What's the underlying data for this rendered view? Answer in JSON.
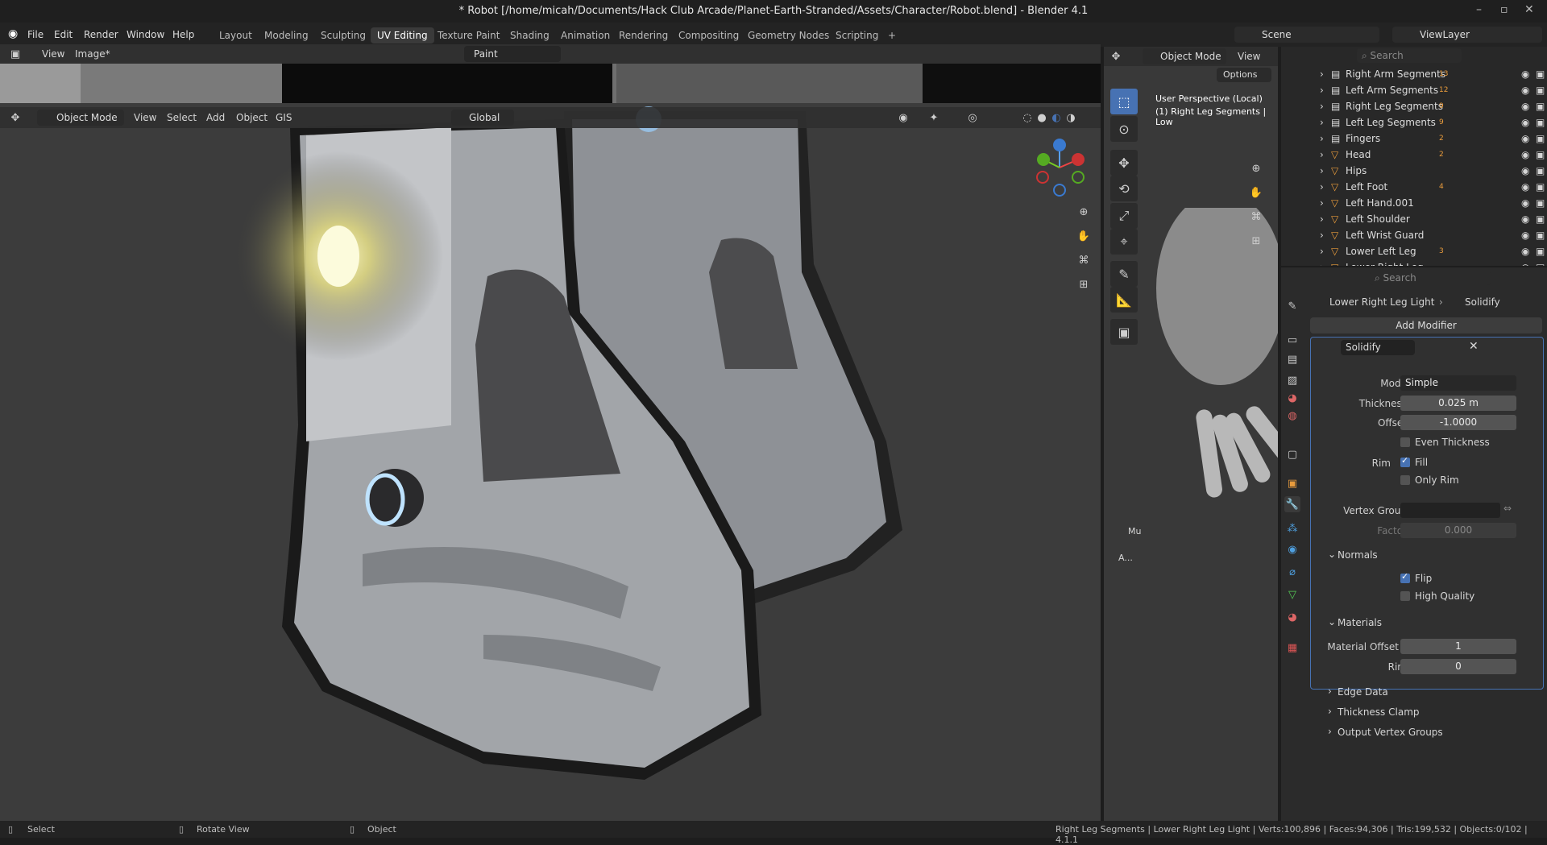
{
  "window": {
    "title": "* Robot [/home/micah/Documents/Hack Club Arcade/Planet-Earth-Stranded/Assets/Character/Robot.blend] - Blender 4.1",
    "min": "–",
    "max": "▫",
    "close": "✕"
  },
  "menu": [
    "File",
    "Edit",
    "Render",
    "Window",
    "Help"
  ],
  "workspaces": [
    "Layout",
    "Modeling",
    "Sculpting",
    "UV Editing",
    "Texture Paint",
    "Shading",
    "Animation",
    "Rendering",
    "Compositing",
    "Geometry Nodes",
    "Scripting"
  ],
  "active_workspace": "UV Editing",
  "add_tab": "+",
  "scene": {
    "label": "Scene",
    "viewlayer": "ViewLayer"
  },
  "image_editor": {
    "view": "View",
    "image": "Image*",
    "paint": "Paint"
  },
  "viewport_header": {
    "mode": "Object Mode",
    "view": "View",
    "select": "Select",
    "add": "Add",
    "object": "Object",
    "gis": "GIS",
    "orientation": "Global"
  },
  "right_view": {
    "mode": "Object Mode",
    "view": "View",
    "options": "Options",
    "persp": "User Perspective (Local)",
    "obj": "(1) Right Leg Segments | Low",
    "mu": "Mu",
    "a": "A..."
  },
  "outliner": {
    "search_placeholder": "Search",
    "items": [
      {
        "name": "Right Arm Segments",
        "badge": "13"
      },
      {
        "name": "Left Arm Segments",
        "badge": "12"
      },
      {
        "name": "Right Leg Segments",
        "badge": "9"
      },
      {
        "name": "Left Leg Segments",
        "badge": "9"
      },
      {
        "name": "Fingers",
        "badge": "2"
      },
      {
        "name": "Head",
        "badge": "2"
      },
      {
        "name": "Hips",
        "badge": ""
      },
      {
        "name": "Left Foot",
        "badge": "4"
      },
      {
        "name": "Left Hand.001",
        "badge": ""
      },
      {
        "name": "Left Shoulder",
        "badge": ""
      },
      {
        "name": "Left Wrist Guard",
        "badge": ""
      },
      {
        "name": "Lower Left Leg",
        "badge": "3"
      },
      {
        "name": "Lower Right Leg",
        "badge": ""
      }
    ]
  },
  "properties": {
    "search_placeholder": "Search",
    "breadcrumb_obj": "Lower Right Leg Light",
    "breadcrumb_mod": "Solidify",
    "add_modifier": "Add Modifier",
    "modifier_name": "Solidify",
    "mode_label": "Mode",
    "mode_value": "Simple",
    "thickness_label": "Thickness",
    "thickness_value": "0.025 m",
    "offset_label": "Offset",
    "offset_value": "-1.0000",
    "even_thickness": "Even Thickness",
    "rim_label": "Rim",
    "fill": "Fill",
    "only_rim": "Only Rim",
    "vgroup_label": "Vertex Group",
    "factor_label": "Factor",
    "factor_value": "0.000",
    "normals": "Normals",
    "flip": "Flip",
    "high_quality": "High Quality",
    "materials": "Materials",
    "mat_offset_label": "Material Offset",
    "mat_offset_value": "1",
    "rim2_label": "Rim",
    "rim2_value": "0",
    "edge_data": "Edge Data",
    "thickness_clamp": "Thickness Clamp",
    "output_vgroups": "Output Vertex Groups"
  },
  "statusbar": {
    "select": "Select",
    "rotate": "Rotate View",
    "object": "Object",
    "stats": "Right Leg Segments | Lower Right Leg Light | Verts:100,896 | Faces:94,306 | Tris:199,532 | Objects:0/102 | 4.1.1"
  },
  "colors": {
    "accent": "#4772b3",
    "panel": "#2b2b2b",
    "header": "#303030"
  }
}
